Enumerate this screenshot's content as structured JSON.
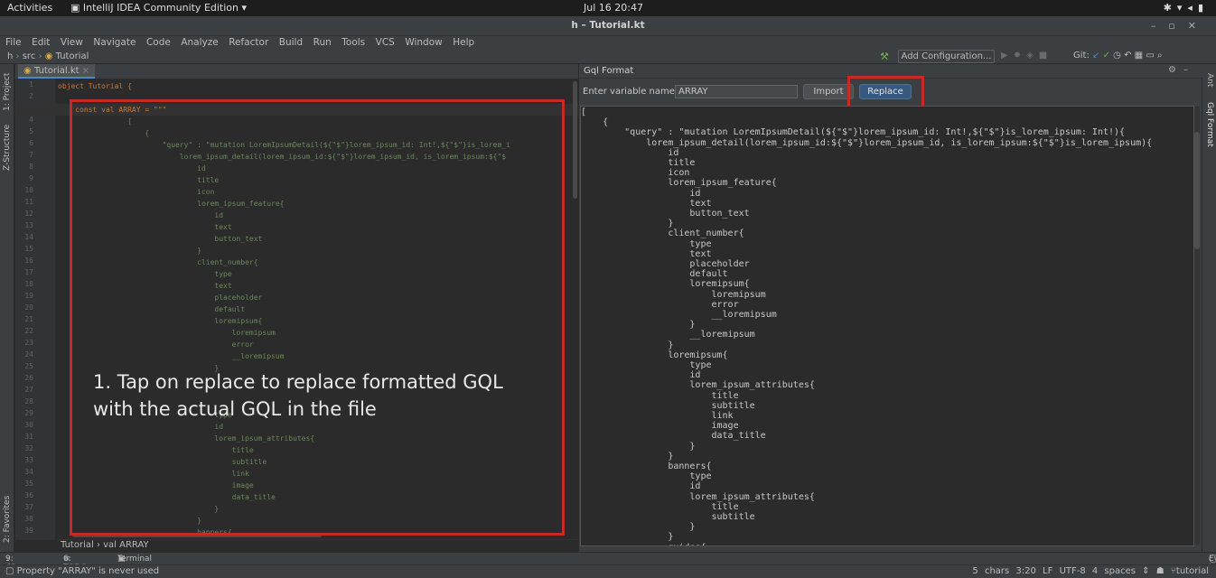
{
  "system_bar": {
    "activities": "Activities",
    "app_name": "IntelliJ IDEA Community Edition ▾",
    "clock": "Jul 16  20:47"
  },
  "window": {
    "title": "h – Tutorial.kt"
  },
  "menu": [
    "File",
    "Edit",
    "View",
    "Navigate",
    "Code",
    "Analyze",
    "Refactor",
    "Build",
    "Run",
    "Tools",
    "VCS",
    "Window",
    "Help"
  ],
  "nav": {
    "project": "h",
    "folder": "src",
    "file": "Tutorial",
    "run_config": "Add Configuration...",
    "git_label": "Git:"
  },
  "left_tool_labels": {
    "project": "1: Project",
    "structure": "Z-Structure",
    "favorites": "2: Favorites"
  },
  "right_tool_labels": {
    "ant": "Ant",
    "gql": "Gql Format"
  },
  "editor_tab": {
    "label": "Tutorial.kt"
  },
  "editor": {
    "lines": [
      {
        "n": "1",
        "t": "object Tutorial {"
      },
      {
        "n": "2",
        "t": ""
      },
      {
        "n": "3",
        "t": "    const val ARRAY = \"\"\""
      },
      {
        "n": "4",
        "t": "                ["
      },
      {
        "n": "5",
        "t": "                    {"
      },
      {
        "n": "6",
        "t": "                        \"query\" : \"mutation LoremIpsumDetail(${\"$\"}lorem_ipsum_id: Int!,${\"$\"}is_lorem_i"
      },
      {
        "n": "7",
        "t": "                            lorem_ipsum_detail(lorem_ipsum_id:${\"$\"}lorem_ipsum_id, is_lorem_ipsum:${\"$"
      },
      {
        "n": "8",
        "t": "                                id"
      },
      {
        "n": "9",
        "t": "                                title"
      },
      {
        "n": "10",
        "t": "                                icon"
      },
      {
        "n": "11",
        "t": "                                lorem_ipsum_feature{"
      },
      {
        "n": "12",
        "t": "                                    id"
      },
      {
        "n": "13",
        "t": "                                    text"
      },
      {
        "n": "14",
        "t": "                                    button_text"
      },
      {
        "n": "15",
        "t": "                                }"
      },
      {
        "n": "16",
        "t": "                                client_number{"
      },
      {
        "n": "17",
        "t": "                                    type"
      },
      {
        "n": "18",
        "t": "                                    text"
      },
      {
        "n": "19",
        "t": "                                    placeholder"
      },
      {
        "n": "20",
        "t": "                                    default"
      },
      {
        "n": "21",
        "t": "                                    loremipsum{"
      },
      {
        "n": "22",
        "t": "                                        loremipsum"
      },
      {
        "n": "23",
        "t": "                                        error"
      },
      {
        "n": "24",
        "t": "                                        __loremipsum"
      },
      {
        "n": "25",
        "t": "                                    }"
      },
      {
        "n": "26",
        "t": ""
      },
      {
        "n": "27",
        "t": ""
      },
      {
        "n": "28",
        "t": ""
      },
      {
        "n": "29",
        "t": "                                    type"
      },
      {
        "n": "30",
        "t": "                                    id"
      },
      {
        "n": "31",
        "t": "                                    lorem_ipsum_attributes{"
      },
      {
        "n": "32",
        "t": "                                        title"
      },
      {
        "n": "33",
        "t": "                                        subtitle"
      },
      {
        "n": "34",
        "t": "                                        link"
      },
      {
        "n": "35",
        "t": "                                        image"
      },
      {
        "n": "36",
        "t": "                                        data_title"
      },
      {
        "n": "37",
        "t": "                                    }"
      },
      {
        "n": "38",
        "t": "                                }"
      },
      {
        "n": "39",
        "t": "                                banners{"
      }
    ]
  },
  "editor_breadcrumb": "Tutorial  ›  val ARRAY",
  "annotation": {
    "line1": "1. Tap on replace to replace formatted GQL",
    "line2": "with the actual GQL in the file"
  },
  "gql_panel": {
    "title": "Gql Format",
    "var_label": "Enter variable name",
    "var_value": "ARRAY",
    "import_label": "Import",
    "replace_label": "Replace",
    "lines": [
      "[",
      "    {",
      "        \"query\" : \"mutation LoremIpsumDetail(${\"$\"}lorem_ipsum_id: Int!,${\"$\"}is_lorem_ipsum: Int!){",
      "            lorem_ipsum_detail(lorem_ipsum_id:${\"$\"}lorem_ipsum_id, is_lorem_ipsum:${\"$\"}is_lorem_ipsum){",
      "                id",
      "                title",
      "                icon",
      "                lorem_ipsum_feature{",
      "                    id",
      "                    text",
      "                    button_text",
      "                }",
      "                client_number{",
      "                    type",
      "                    text",
      "                    placeholder",
      "                    default",
      "                    loremipsum{",
      "                        loremipsum",
      "                        error",
      "                        __loremipsum",
      "                    }",
      "                    __loremipsum",
      "                }",
      "                loremipsum{",
      "                    type",
      "                    id",
      "                    lorem_ipsum_attributes{",
      "                        title",
      "                        subtitle",
      "                        link",
      "                        image",
      "                        data_title",
      "                    }",
      "                }",
      "                banners{",
      "                    type",
      "                    id",
      "                    lorem_ipsum_attributes{",
      "                        title",
      "                        subtitle",
      "                    }",
      "                }",
      "                guides{"
    ]
  },
  "tool_windows": {
    "git": "9: Git",
    "todo": "6: TODO",
    "terminal": "Terminal",
    "event_log": "Event Log"
  },
  "status": {
    "message": "Property \"ARRAY\" is never used",
    "info": "5 chars  3:20  LF  UTF-8  4 spaces",
    "branch": "tutorial"
  }
}
